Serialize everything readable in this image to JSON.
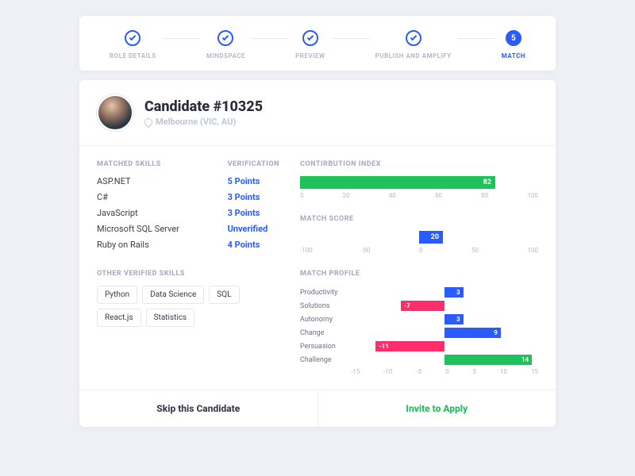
{
  "stepper": {
    "steps": [
      {
        "label": "ROLE DETAILS",
        "done": true
      },
      {
        "label": "MINDSPACE",
        "done": true
      },
      {
        "label": "PREVIEW",
        "done": true
      },
      {
        "label": "PUBLISH AND AMPLIFY",
        "done": true
      },
      {
        "label": "MATCH",
        "active": true,
        "number": "5"
      }
    ]
  },
  "candidate": {
    "name": "Candidate #10325",
    "location": "Melbourne (VIC, AU)"
  },
  "sections": {
    "matched_skills": "MATCHED SKILLS",
    "verification": "VERIFICATION",
    "other": "OTHER VERIFIED SKILLS",
    "contribution": "CONTIRBUTION INDEX",
    "match_score": "MATCH SCORE",
    "match_profile": "MATCH PROFILE"
  },
  "skills": [
    {
      "name": "ASP.NET",
      "verif": "5 Points"
    },
    {
      "name": "C#",
      "verif": "3 Points"
    },
    {
      "name": "JavaScript",
      "verif": "3 Points"
    },
    {
      "name": "Microsoft SQL Server",
      "verif": "Unverified"
    },
    {
      "name": "Ruby on Rails",
      "verif": "4 Points"
    }
  ],
  "other_skills": [
    "Python",
    "Data Science",
    "SQL",
    "React.js",
    "Statistics"
  ],
  "footer": {
    "skip": "Skip this Candidate",
    "invite": "Invite to Apply"
  },
  "chart_data": [
    {
      "type": "bar",
      "orientation": "h",
      "title": "CONTIRBUTION INDEX",
      "categories": [
        ""
      ],
      "values": [
        82
      ],
      "xlim": [
        0,
        100
      ],
      "ticks": [
        "0",
        "20",
        "40",
        "60",
        "80",
        "100"
      ],
      "color": "#1fc15a"
    },
    {
      "type": "bar",
      "orientation": "h",
      "title": "MATCH SCORE",
      "categories": [
        ""
      ],
      "values": [
        20
      ],
      "xlim": [
        -100,
        100
      ],
      "ticks": [
        "-100",
        "-50",
        "0",
        "50",
        "100"
      ],
      "color": "#2a5bff"
    },
    {
      "type": "bar",
      "orientation": "h",
      "title": "MATCH PROFILE",
      "categories": [
        "Productivity",
        "Solutions",
        "Autonomy",
        "Change",
        "Persuasion",
        "Challenge"
      ],
      "values": [
        3,
        -7,
        3,
        9,
        -11,
        14
      ],
      "xlim": [
        -15,
        15
      ],
      "ticks": [
        "-15",
        "-10",
        "-5",
        "0",
        "5",
        "10",
        "15"
      ],
      "colors": {
        "pos": "#2a5bff",
        "neg": "#ff2d6b",
        "special": "#1fc15a"
      }
    }
  ]
}
